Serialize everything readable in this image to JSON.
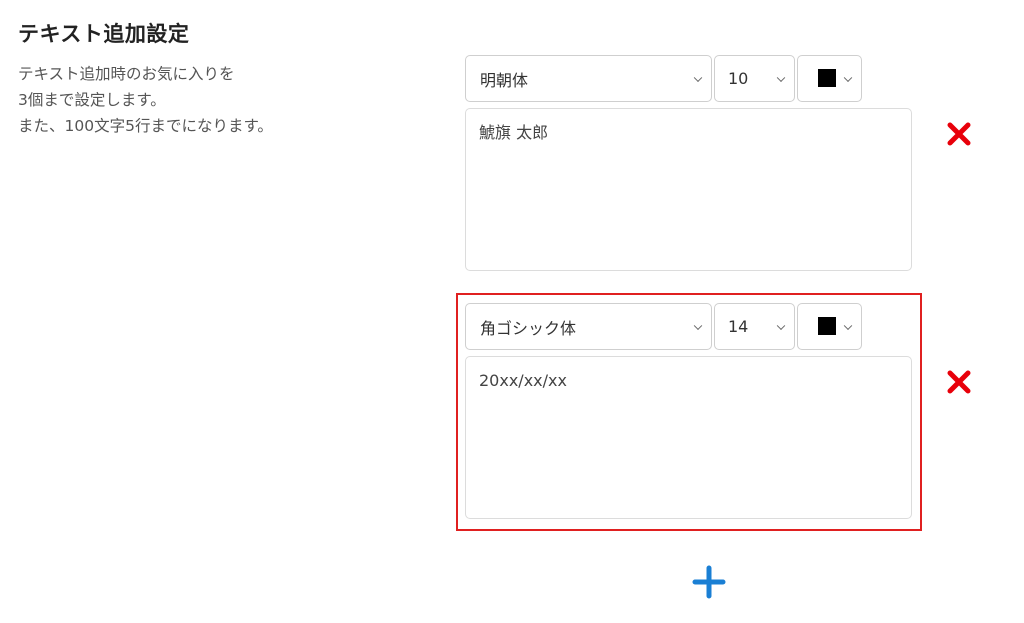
{
  "header": {
    "title": "テキスト追加設定"
  },
  "description": {
    "lines": [
      "テキスト追加時のお気に入りを",
      "3個まで設定します。",
      "また、100文字5行までになります。"
    ]
  },
  "text_settings": [
    {
      "font": "明朝体",
      "size": "10",
      "color": "#000000",
      "text": "鯱旗 太郎"
    },
    {
      "font": "角ゴシック体",
      "size": "14",
      "color": "#000000",
      "text": "20xx/xx/xx"
    }
  ],
  "icons": {
    "delete": "close-icon",
    "add": "plus-icon"
  },
  "colors": {
    "delete_icon": "#e8000a",
    "add_icon": "#1a7fd4",
    "highlight_border": "#e02020"
  }
}
